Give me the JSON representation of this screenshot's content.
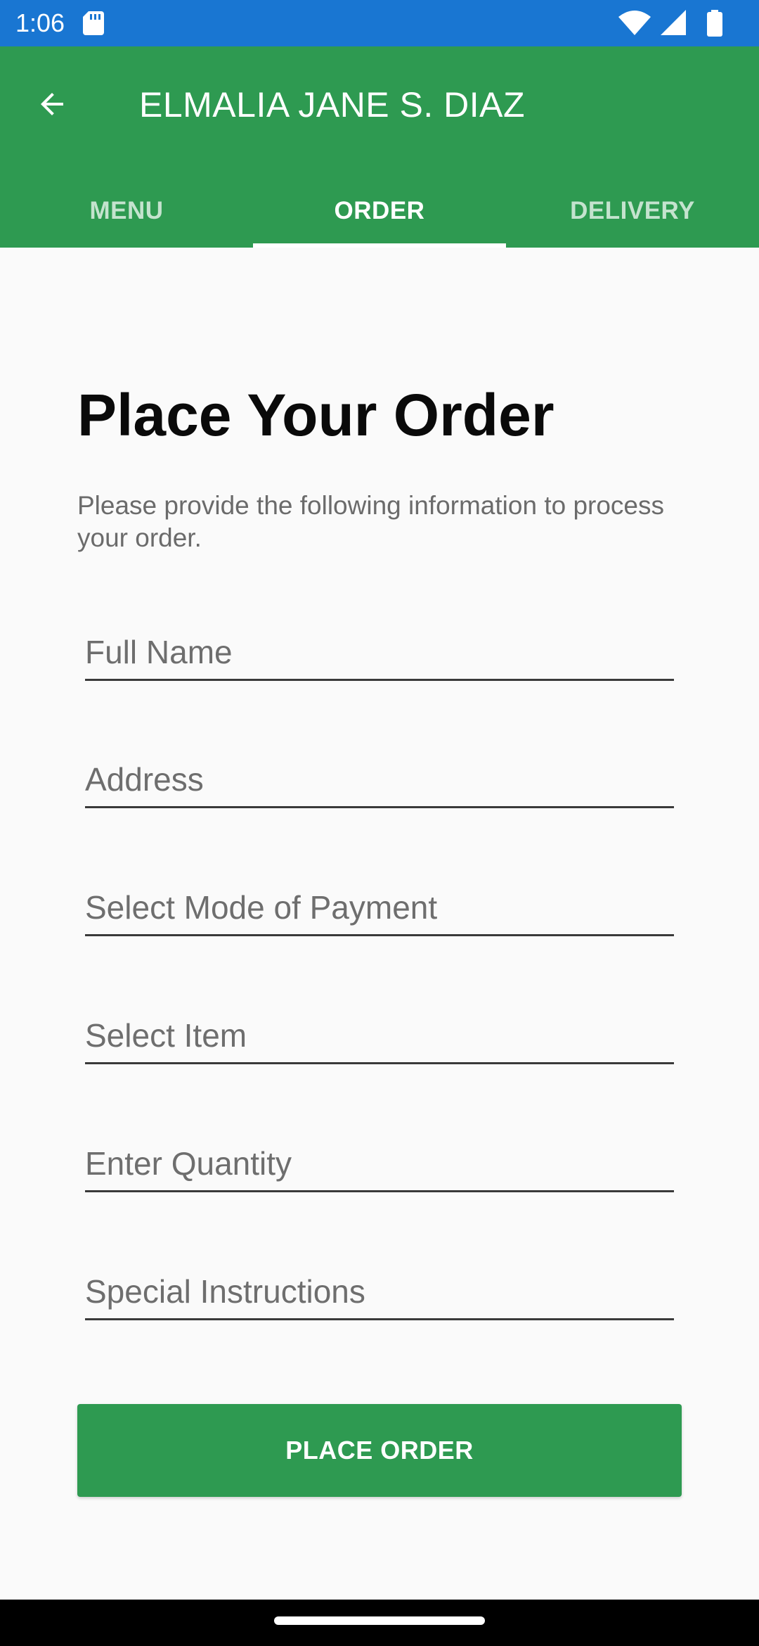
{
  "status_bar": {
    "time": "1:06",
    "icons": [
      "sd-card-icon",
      "wifi-icon",
      "cellular-signal-icon",
      "battery-icon"
    ]
  },
  "app_bar": {
    "title": "ELMALIA JANE S. DIAZ",
    "background_color": "#2e9a51",
    "back_icon": "arrow-back-icon"
  },
  "tabs": [
    {
      "label": "MENU",
      "active": false
    },
    {
      "label": "ORDER",
      "active": true
    },
    {
      "label": "DELIVERY",
      "active": false
    }
  ],
  "main": {
    "title": "Place Your Order",
    "subtitle": "Please provide the following information to process your order.",
    "fields": {
      "full_name": {
        "placeholder": "Full Name",
        "value": ""
      },
      "address": {
        "placeholder": "Address",
        "value": ""
      },
      "payment": {
        "placeholder": "Select Mode of Payment",
        "value": ""
      },
      "item": {
        "placeholder": "Select Item",
        "value": ""
      },
      "quantity": {
        "placeholder": "Enter Quantity",
        "value": ""
      },
      "instructions": {
        "placeholder": "Special Instructions",
        "value": ""
      }
    },
    "submit_label": "PLACE ORDER"
  },
  "colors": {
    "status_bar": "#1976d2",
    "accent": "#2e9a51",
    "background": "#fafafa"
  }
}
